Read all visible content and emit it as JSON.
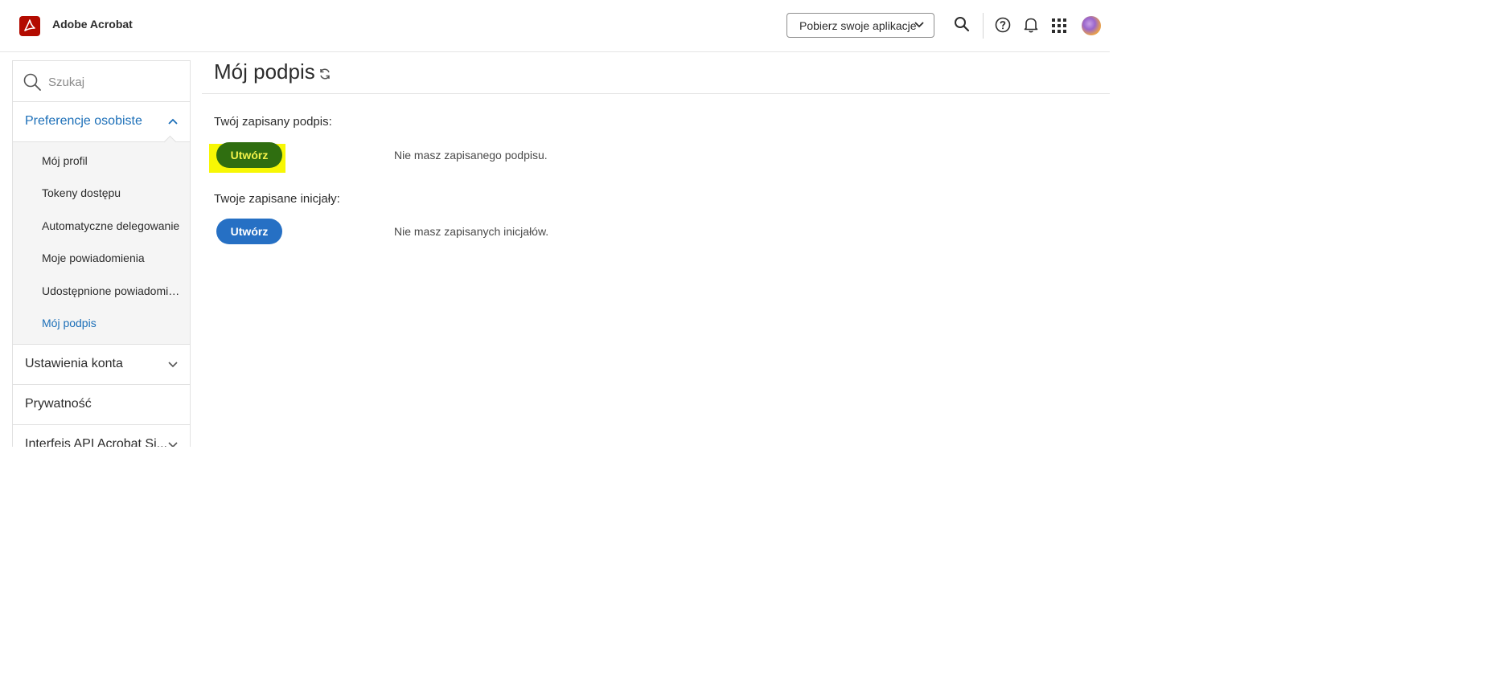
{
  "header": {
    "brand": "Adobe Acrobat",
    "apps_button": "Pobierz swoje aplikacje",
    "icons": [
      "search-icon",
      "help-icon",
      "bell-icon",
      "app-grid-icon",
      "avatar"
    ]
  },
  "sidebar": {
    "search_placeholder": "Szukaj",
    "sections": [
      {
        "label": "Preferencje osobiste",
        "expanded": true,
        "items": [
          {
            "label": "Mój profil"
          },
          {
            "label": "Tokeny dostępu"
          },
          {
            "label": "Automatyczne delegowanie"
          },
          {
            "label": "Moje powiadomienia"
          },
          {
            "label": "Udostępnione powiadomienia"
          },
          {
            "label": "Mój podpis",
            "active": true
          }
        ]
      },
      {
        "label": "Ustawienia konta",
        "expanded": false
      },
      {
        "label": "Prywatność"
      },
      {
        "label": "Interfejs API Acrobat Si...",
        "expanded": false
      }
    ]
  },
  "main": {
    "title": "Mój podpis",
    "signature": {
      "label": "Twój zapisany podpis:",
      "button": "Utwórz",
      "empty_text": "Nie masz zapisanego podpisu."
    },
    "initials": {
      "label": "Twoje zapisane inicjały:",
      "button": "Utwórz",
      "empty_text": "Nie masz zapisanych inicjałów."
    }
  },
  "colors": {
    "accent_blue": "#1c6fb8",
    "button_blue": "#2670c4",
    "button_highlighted": "#2f6e10",
    "highlight_yellow": "#f7f704",
    "acrobat_red": "#b30b00"
  }
}
